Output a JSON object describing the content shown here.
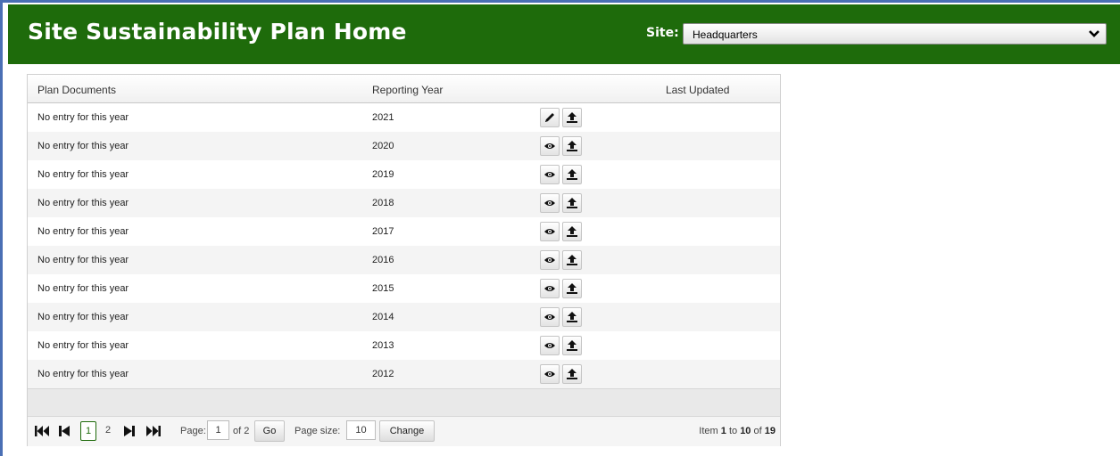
{
  "header": {
    "title": "Site Sustainability Plan Home",
    "site_label": "Site:",
    "site_value": "Headquarters"
  },
  "colors": {
    "header_bg": "#1e6b0b",
    "frame": "#4a6fb4"
  },
  "table": {
    "columns": [
      "Plan Documents",
      "Reporting Year",
      "Last Updated"
    ],
    "rows": [
      {
        "doc": "No entry for this year",
        "year": "2021",
        "action_icon": "pencil-icon"
      },
      {
        "doc": "No entry for this year",
        "year": "2020",
        "action_icon": "eye-icon"
      },
      {
        "doc": "No entry for this year",
        "year": "2019",
        "action_icon": "eye-icon"
      },
      {
        "doc": "No entry for this year",
        "year": "2018",
        "action_icon": "eye-icon"
      },
      {
        "doc": "No entry for this year",
        "year": "2017",
        "action_icon": "eye-icon"
      },
      {
        "doc": "No entry for this year",
        "year": "2016",
        "action_icon": "eye-icon"
      },
      {
        "doc": "No entry for this year",
        "year": "2015",
        "action_icon": "eye-icon"
      },
      {
        "doc": "No entry for this year",
        "year": "2014",
        "action_icon": "eye-icon"
      },
      {
        "doc": "No entry for this year",
        "year": "2013",
        "action_icon": "eye-icon"
      },
      {
        "doc": "No entry for this year",
        "year": "2012",
        "action_icon": "eye-icon"
      }
    ]
  },
  "pager": {
    "pages": [
      "1",
      "2"
    ],
    "current_page": "1",
    "page_label": "Page:",
    "page_input": "1",
    "of_label": "of 2",
    "go_label": "Go",
    "page_size_label": "Page size:",
    "page_size_value": "10",
    "change_label": "Change",
    "item_prefix": "Item",
    "item_from": "1",
    "item_to_word": "to",
    "item_to": "10",
    "item_of_word": "of",
    "item_total": "19"
  }
}
